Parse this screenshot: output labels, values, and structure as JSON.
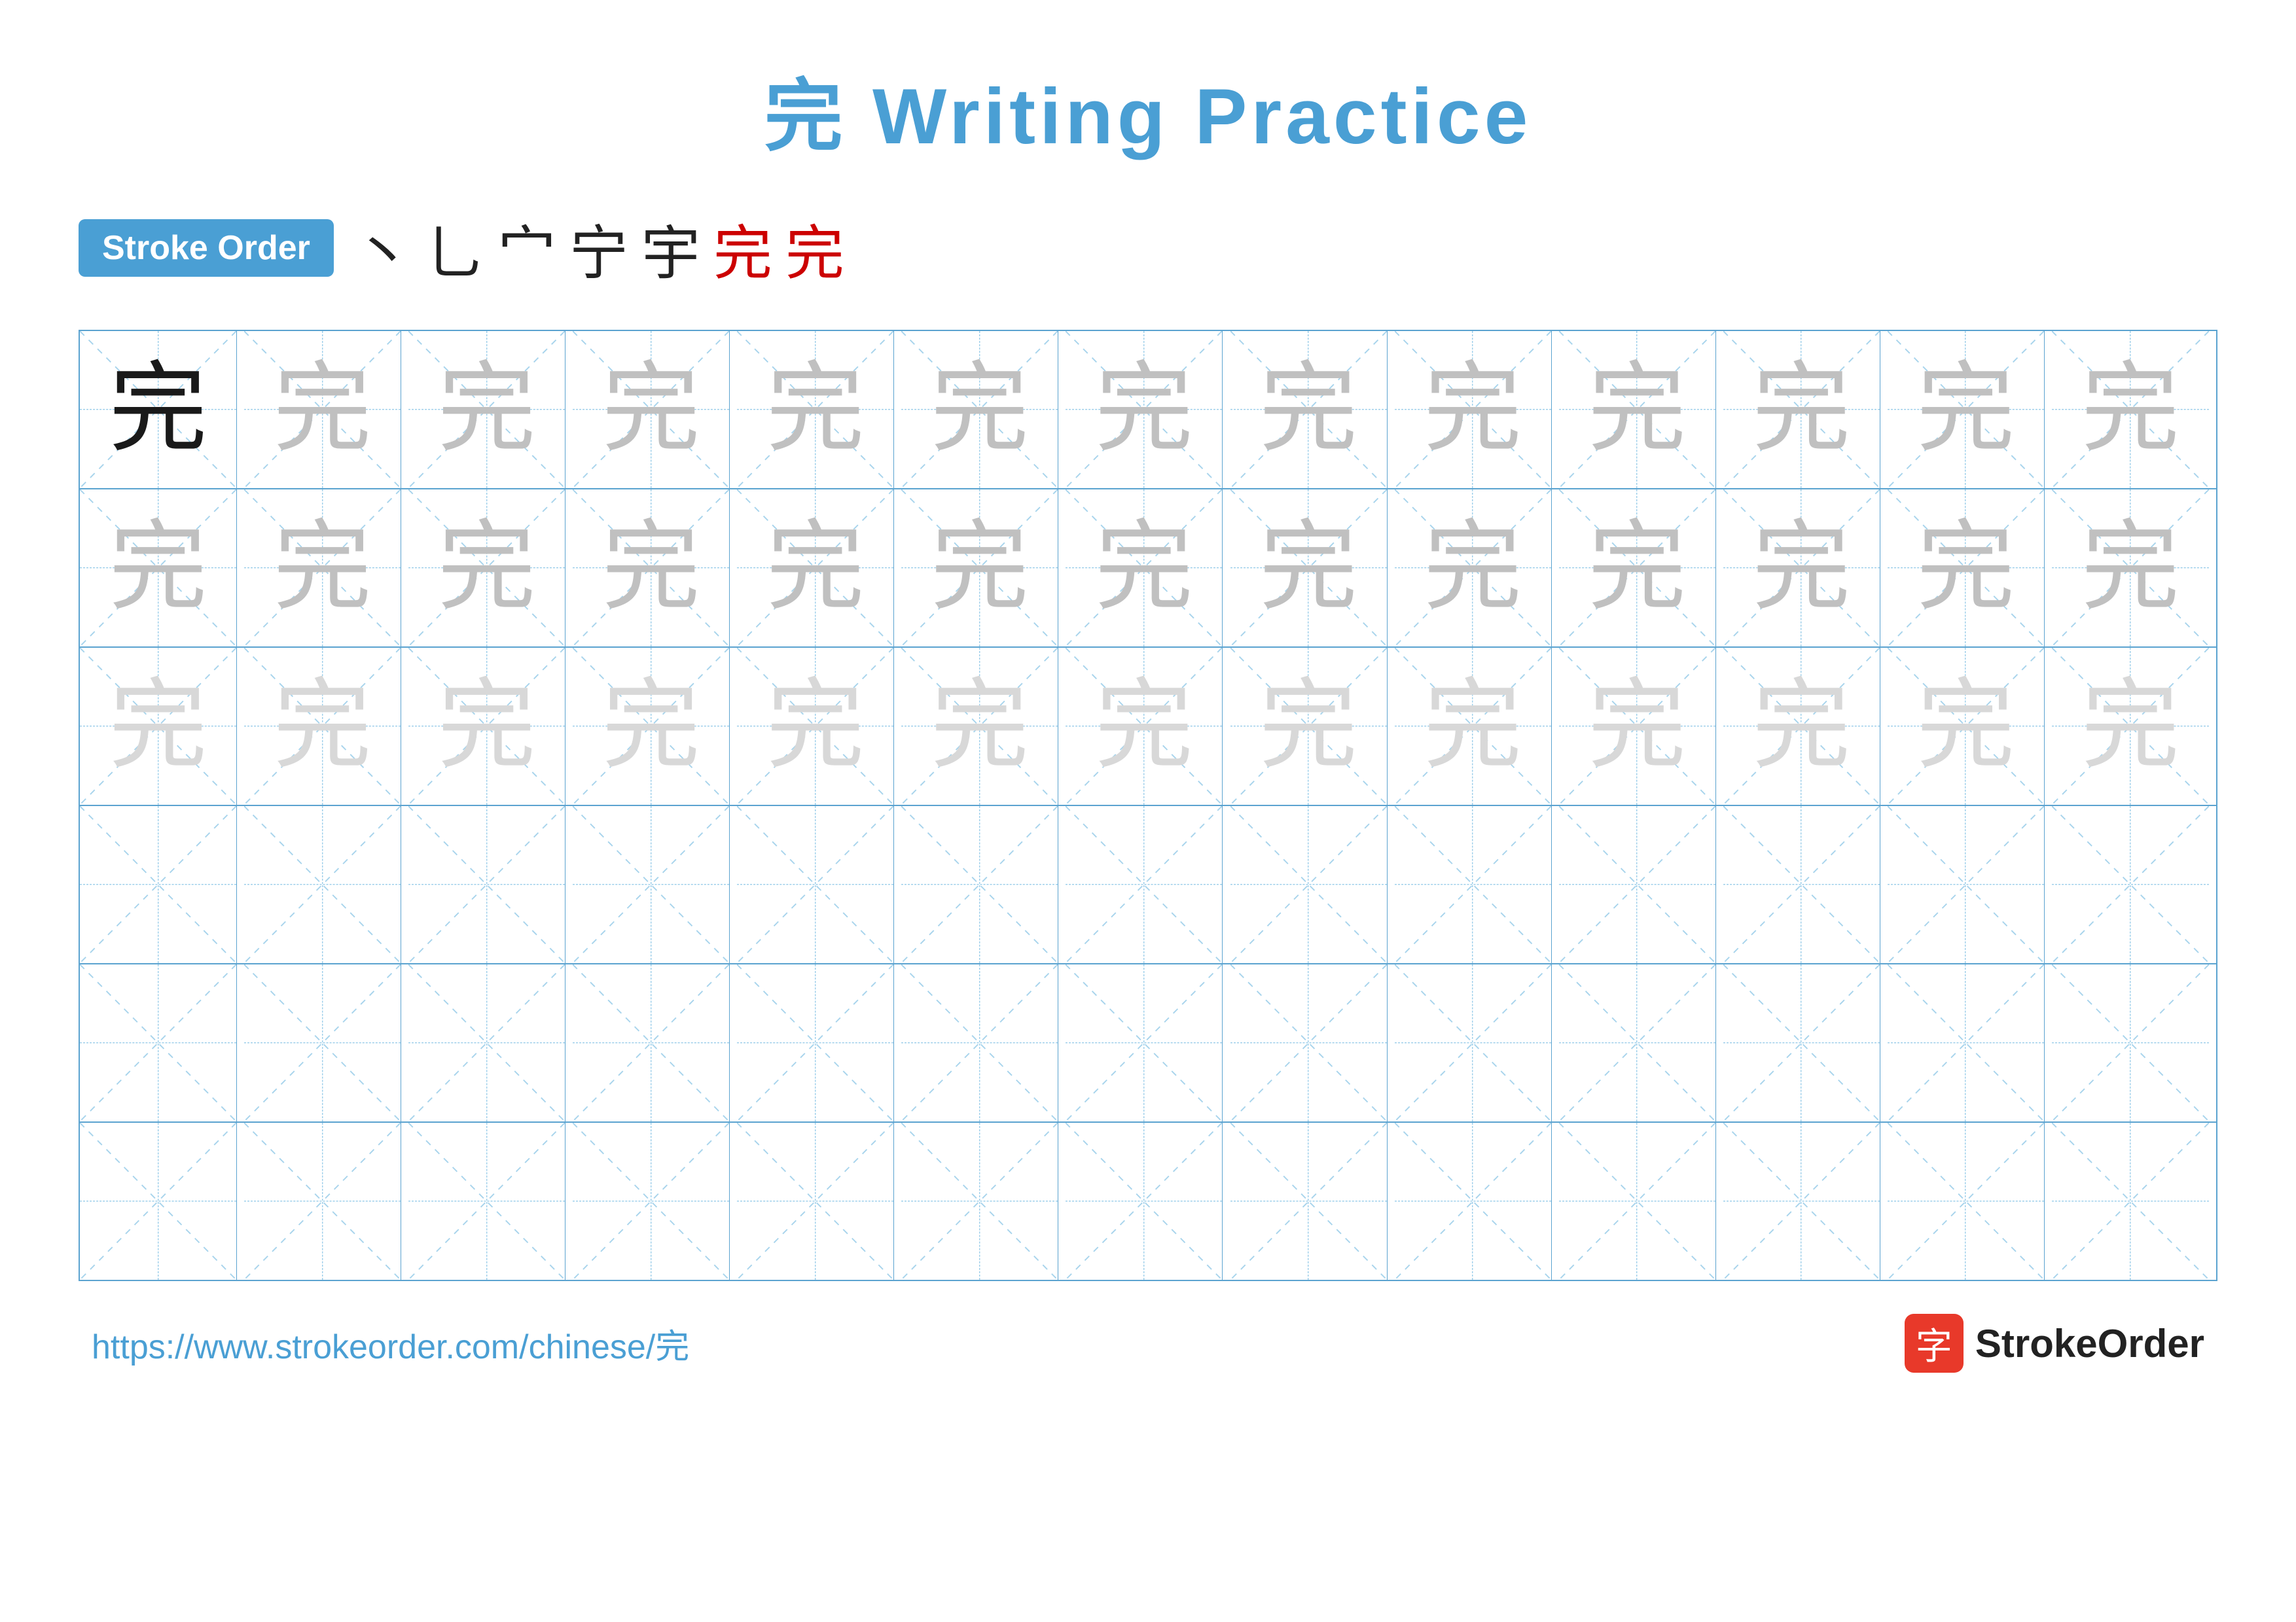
{
  "title": {
    "char": "完",
    "text": " Writing Practice"
  },
  "stroke_order": {
    "badge_label": "Stroke Order",
    "strokes": [
      "丶",
      "ㄟ",
      "宀",
      "宁",
      "宇",
      "完",
      "完"
    ]
  },
  "grid": {
    "rows": 6,
    "cols": 13,
    "cells": [
      [
        "dark",
        "light",
        "light",
        "light",
        "light",
        "light",
        "light",
        "light",
        "light",
        "light",
        "light",
        "light",
        "light"
      ],
      [
        "light",
        "light",
        "light",
        "light",
        "light",
        "light",
        "light",
        "light",
        "light",
        "light",
        "light",
        "light",
        "light"
      ],
      [
        "lighter",
        "lighter",
        "lighter",
        "lighter",
        "lighter",
        "lighter",
        "lighter",
        "lighter",
        "lighter",
        "lighter",
        "lighter",
        "lighter",
        "lighter"
      ],
      [
        "empty",
        "empty",
        "empty",
        "empty",
        "empty",
        "empty",
        "empty",
        "empty",
        "empty",
        "empty",
        "empty",
        "empty",
        "empty"
      ],
      [
        "empty",
        "empty",
        "empty",
        "empty",
        "empty",
        "empty",
        "empty",
        "empty",
        "empty",
        "empty",
        "empty",
        "empty",
        "empty"
      ],
      [
        "empty",
        "empty",
        "empty",
        "empty",
        "empty",
        "empty",
        "empty",
        "empty",
        "empty",
        "empty",
        "empty",
        "empty",
        "empty"
      ]
    ]
  },
  "footer": {
    "url": "https://www.strokeorder.com/chinese/完",
    "logo_char": "字",
    "logo_text": "StrokeOrder"
  },
  "colors": {
    "blue": "#4A9FD4",
    "red": "#E8392A",
    "dark_char": "#1a1a1a",
    "light_char": "#c8c8c8",
    "lighter_char": "#dedede",
    "grid_border": "#5BA3D0",
    "grid_dash": "#A8D4EC"
  }
}
